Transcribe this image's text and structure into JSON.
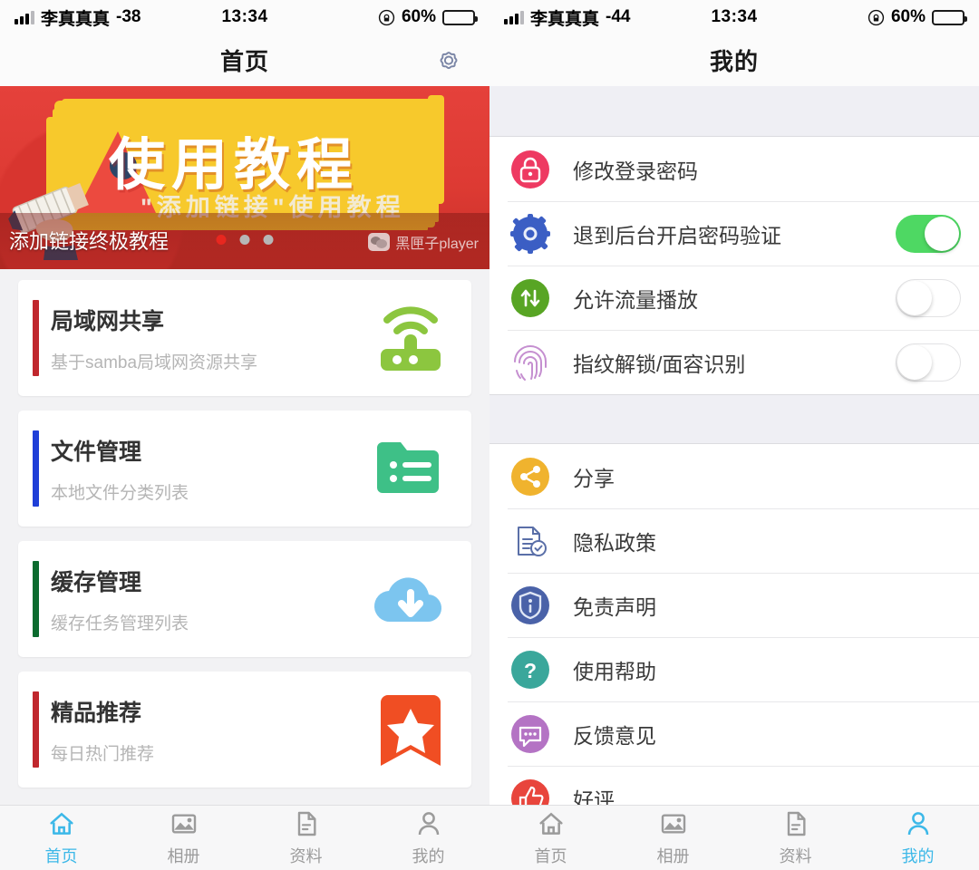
{
  "left": {
    "status": {
      "carrier": "李真真真",
      "rssi": "-38",
      "time": "13:34",
      "battery": "60%"
    },
    "nav": {
      "title": "首页",
      "action_icon": "gear-icon"
    },
    "banner": {
      "title": "使用教程",
      "subtitle": "\"添加链接\"使用教程",
      "caption": "添加链接终极教程",
      "watermark": "黑匣子player",
      "dots": 3,
      "active_dot": 0
    },
    "cards": [
      {
        "title": "局域网共享",
        "desc": "基于samba局域网资源共享",
        "bar_color": "#c0272d",
        "icon": "wifi-router-icon",
        "icon_color": "#8cc63f"
      },
      {
        "title": "文件管理",
        "desc": "本地文件分类列表",
        "bar_color": "#1f3fd8",
        "icon": "folder-list-icon",
        "icon_color": "#3ec087"
      },
      {
        "title": "缓存管理",
        "desc": "缓存任务管理列表",
        "bar_color": "#0b6b2e",
        "icon": "cloud-download-icon",
        "icon_color": "#7cc5ef"
      },
      {
        "title": "精品推荐",
        "desc": "每日热门推荐",
        "bar_color": "#c0272d",
        "icon": "bookmark-star-icon",
        "icon_color": "#f04e23"
      }
    ],
    "tabs": [
      {
        "label": "首页",
        "icon": "home-icon",
        "active": true
      },
      {
        "label": "相册",
        "icon": "photo-icon",
        "active": false
      },
      {
        "label": "资料",
        "icon": "document-icon",
        "active": false
      },
      {
        "label": "我的",
        "icon": "person-icon",
        "active": false
      }
    ]
  },
  "right": {
    "status": {
      "carrier": "李真真真",
      "rssi": "-44",
      "time": "13:34",
      "battery": "60%"
    },
    "nav": {
      "title": "我的"
    },
    "group1": [
      {
        "label": "修改登录密码",
        "icon": "lock-icon",
        "icon_color": "#ee3a62",
        "control": "none"
      },
      {
        "label": "退到后台开启密码验证",
        "icon": "gear-icon",
        "icon_color": "#3b5ec4",
        "control": "toggle",
        "on": true
      },
      {
        "label": "允许流量播放",
        "icon": "data-transfer-icon",
        "icon_color": "#58a524",
        "control": "toggle",
        "on": false
      },
      {
        "label": "指纹解锁/面容识别",
        "icon": "fingerprint-icon",
        "icon_color": "#c58fd0",
        "control": "toggle",
        "on": false
      }
    ],
    "group2": [
      {
        "label": "分享",
        "icon": "share-icon",
        "icon_color": "#f0b32e"
      },
      {
        "label": "隐私政策",
        "icon": "privacy-doc-icon",
        "icon_color": "#5a6fa8"
      },
      {
        "label": "免责声明",
        "icon": "shield-info-icon",
        "icon_color": "#4a62a8"
      },
      {
        "label": "使用帮助",
        "icon": "question-icon",
        "icon_color": "#3aa79b"
      },
      {
        "label": "反馈意见",
        "icon": "feedback-chat-icon",
        "icon_color": "#b473c4"
      },
      {
        "label": "好评",
        "icon": "thumbs-up-icon",
        "icon_color": "#e8453c"
      }
    ],
    "tabs": [
      {
        "label": "首页",
        "icon": "home-icon",
        "active": false
      },
      {
        "label": "相册",
        "icon": "photo-icon",
        "active": false
      },
      {
        "label": "资料",
        "icon": "document-icon",
        "active": false
      },
      {
        "label": "我的",
        "icon": "person-icon",
        "active": true
      }
    ]
  },
  "colors": {
    "accent_blue": "#3cb8e8",
    "toggle_on": "#4ed863",
    "banner_red": "#e23b38",
    "banner_yellow": "#f7c92c"
  }
}
